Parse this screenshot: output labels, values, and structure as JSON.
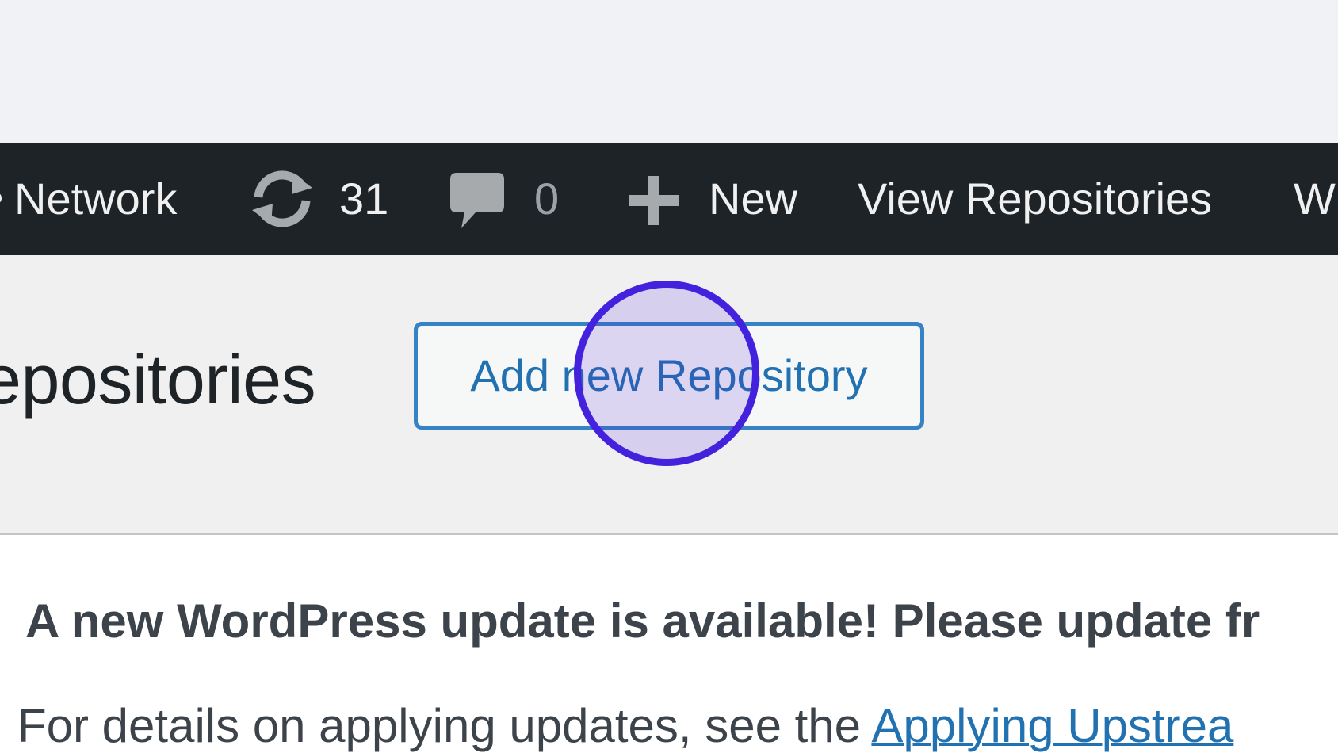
{
  "admin_bar": {
    "network_label": "Network",
    "updates_count": "31",
    "comments_count": "0",
    "new_label": "New",
    "view_label": "View Repositories",
    "truncated_label": "W"
  },
  "header": {
    "title": "epositories",
    "add_button_label": "Add new Repository"
  },
  "notice": {
    "title": "A new WordPress update is available! Please update fr",
    "body_prefix": "For details on applying updates, see the ",
    "link_text": "Applying Upstrea"
  },
  "colors": {
    "admin_bar_bg": "#1d2327",
    "button_border": "#3582c4",
    "link": "#2271b1",
    "click_indicator": "#4422dd"
  },
  "icons": {
    "updates": "refresh-icon",
    "comments": "comment-bubble-icon",
    "new": "plus-icon"
  }
}
